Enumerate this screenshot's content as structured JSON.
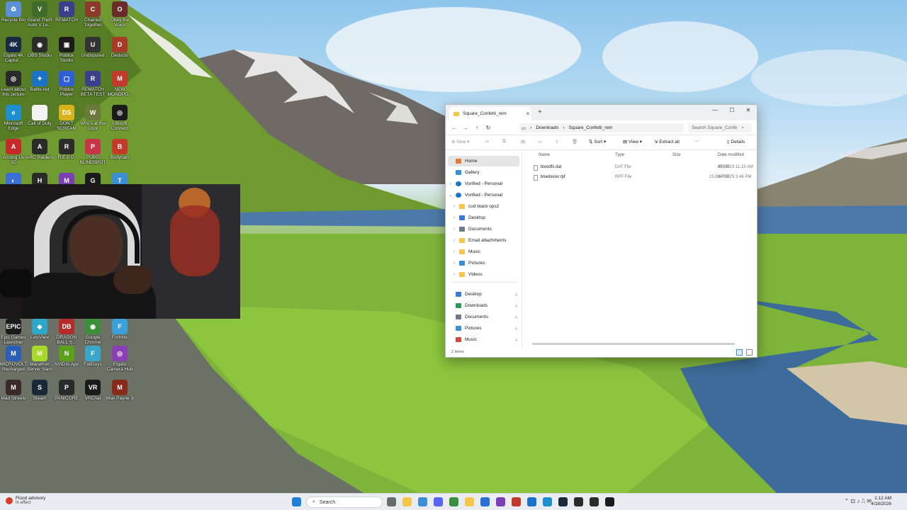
{
  "desktop": {
    "icons": [
      {
        "label": "Recycle Bin",
        "icon": "recycle-bin-icon",
        "color": "#5b8fd6",
        "glyph": "♻"
      },
      {
        "label": "Grand Theft Auto V Le...",
        "icon": "gta-icon",
        "color": "#3f6c2a",
        "glyph": "V"
      },
      {
        "label": "REMATCH",
        "icon": "rematch-icon",
        "color": "#3b3f8a",
        "glyph": "R"
      },
      {
        "label": "Chained Together",
        "icon": "chained-together-icon",
        "color": "#8a3b2b",
        "glyph": "C"
      },
      {
        "label": "Obey the Voice",
        "icon": "obey-icon",
        "color": "#6b2b2b",
        "glyph": "O"
      },
      {
        "label": "Elgato 4K Captur...",
        "icon": "elgato-icon",
        "color": "#1b2a44",
        "glyph": "4K"
      },
      {
        "label": "OBS Studio",
        "icon": "obs-icon",
        "color": "#2b2b2b",
        "glyph": "◉"
      },
      {
        "label": "Roblox Studio",
        "icon": "roblox-studio-icon",
        "color": "#1b1b1b",
        "glyph": "▣"
      },
      {
        "label": "Undisputed",
        "icon": "undisputed-icon",
        "color": "#333",
        "glyph": "U"
      },
      {
        "label": "Deducto",
        "icon": "deducto-icon",
        "color": "#a83a2a",
        "glyph": "D"
      },
      {
        "label": "Learn about this picture",
        "icon": "learn-picture-icon",
        "color": "#2a2a2a",
        "glyph": "◎"
      },
      {
        "label": "Battle.net",
        "icon": "battlenet-icon",
        "color": "#1a73c9",
        "glyph": "✦"
      },
      {
        "label": "Roblox Player",
        "icon": "roblox-player-icon",
        "color": "#2f5ed9",
        "glyph": "▢"
      },
      {
        "label": "REMATCH BETA TEST",
        "icon": "rematch-beta-icon",
        "color": "#3b3f8a",
        "glyph": "R"
      },
      {
        "label": "NEW MONOPO...",
        "icon": "monopoly-icon",
        "color": "#c33a2c",
        "glyph": "M"
      },
      {
        "label": "Microsoft Edge",
        "icon": "edge-icon",
        "color": "#1e8ecf",
        "glyph": "e"
      },
      {
        "label": "Call of Duty",
        "icon": "cod-icon",
        "color": "#f2f2f2",
        "glyph": "□"
      },
      {
        "label": "DON'T SCREAM",
        "icon": "dont-scream-icon",
        "color": "#d9b31a",
        "glyph": "DS"
      },
      {
        "label": "Who's at the Door",
        "icon": "whos-door-icon",
        "color": "#6b7a3a",
        "glyph": "W"
      },
      {
        "label": "Ubisoft Connect",
        "icon": "ubisoft-icon",
        "color": "#1b1b1b",
        "glyph": "◎"
      },
      {
        "label": "Among Us 3D",
        "icon": "among-us-icon",
        "color": "#c42a2a",
        "glyph": "A"
      },
      {
        "label": "ARC Raiders",
        "icon": "arc-raiders-icon",
        "color": "#2b2b2b",
        "glyph": "A"
      },
      {
        "label": "R.E.P.O.",
        "icon": "repo-icon",
        "color": "#2b2b2b",
        "glyph": "R"
      },
      {
        "label": "PUBG BLINDSPOT",
        "icon": "pubg-icon",
        "color": "#c7354a",
        "glyph": "P"
      },
      {
        "label": "Bodycam",
        "icon": "bodycam-icon",
        "color": "#c23a2a",
        "glyph": "B"
      },
      {
        "label": "Chrome Shortcut",
        "icon": "chrome-shortcut-icon",
        "color": "#3b6fd6",
        "glyph": "◐"
      },
      {
        "label": "HACK STUDIO Studio",
        "icon": "hack-studio-icon",
        "color": "#2a2a2a",
        "glyph": "H"
      },
      {
        "label": "Mobile Party",
        "icon": "mobile-party-icon",
        "color": "#7a3fb5",
        "glyph": "M"
      },
      {
        "label": "Logitech G HUB",
        "icon": "logitech-icon",
        "color": "#1b1b1b",
        "glyph": "G"
      },
      {
        "label": "The Texas Chain Saw...",
        "icon": "texas-chainsaw-icon",
        "color": "#3b8fd6",
        "glyph": "T"
      },
      {
        "label": "Epic Games Launcher",
        "icon": "epic-icon",
        "color": "#1b1b1b",
        "glyph": "EPIC"
      },
      {
        "label": "LetsView",
        "icon": "letsview-icon",
        "color": "#2ea8c9",
        "glyph": "◆"
      },
      {
        "label": "DRAGON BALL S...",
        "icon": "dragonball-icon",
        "color": "#b52a2a",
        "glyph": "DB"
      },
      {
        "label": "Google Chrome",
        "icon": "chrome-icon",
        "color": "#3b8f3b",
        "glyph": "◉"
      },
      {
        "label": "Fortnite",
        "icon": "fortnite-icon",
        "color": "#3aa0d9",
        "glyph": "F"
      },
      {
        "label": "MICROVOLTS Recharged",
        "icon": "microvolts-icon",
        "color": "#2a5fb5",
        "glyph": "M"
      },
      {
        "label": "Marathon Server Slam",
        "icon": "marathon-icon",
        "color": "#a8d92a",
        "glyph": "M"
      },
      {
        "label": "NVIDIA App",
        "icon": "nvidia-icon",
        "color": "#5aa01a",
        "glyph": "N"
      },
      {
        "label": "FallGuys",
        "icon": "fallguys-icon",
        "color": "#3aa6c9",
        "glyph": "F"
      },
      {
        "label": "Elgato Camera Hub",
        "icon": "camera-hub-icon",
        "color": "#8a3fb5",
        "glyph": "◎"
      },
      {
        "label": "Mad Streets",
        "icon": "mad-streets-icon",
        "color": "#3a2a2a",
        "glyph": "M"
      },
      {
        "label": "Steam",
        "icon": "steam-icon",
        "color": "#1b2838",
        "glyph": "S"
      },
      {
        "label": "PANICORE",
        "icon": "panicore-icon",
        "color": "#2a2a2a",
        "glyph": "P"
      },
      {
        "label": "VRChat",
        "icon": "vrchat-icon",
        "color": "#1b1b1b",
        "glyph": "VR"
      },
      {
        "label": "Max Payne 3",
        "icon": "max-payne-icon",
        "color": "#8a2a1a",
        "glyph": "M"
      }
    ]
  },
  "explorer": {
    "tab_title": "Square_Confetti_rem",
    "breadcrumbs": [
      "Downloads",
      "Square_Confetti_rem"
    ],
    "search_placeholder": "Search Square_Confe",
    "toolbar": {
      "new": "New",
      "sort": "Sort",
      "view": "View",
      "extract": "Extract all",
      "more": "···",
      "details": "Details"
    },
    "nav": {
      "home": "Home",
      "gallery": "Gallery",
      "onedrive1": "Vorified - Personal",
      "onedrive2": "Vorified - Personal",
      "folders": [
        "cod black ops2",
        "Desktop",
        "Documents",
        "Email attachments",
        "Music",
        "Pictures",
        "Videos"
      ],
      "quick": [
        "Desktop",
        "Downloads",
        "Documents",
        "Pictures",
        "Music"
      ]
    },
    "columns": {
      "name": "Name",
      "type": "Type",
      "size": "Size",
      "date": "Date modified"
    },
    "files": [
      {
        "name": "bloodfx.dat",
        "type": "DAT File",
        "size": "45 KB",
        "date": "3/5/2023 11:15 AM"
      },
      {
        "name": "bluebocer.rpf",
        "type": "RPF File",
        "size": "15,884 KB",
        "date": "8/7/2025 3:46 PM"
      }
    ],
    "status": "2 items"
  },
  "taskbar": {
    "weather_title": "Flood advisory",
    "weather_sub": "In effect",
    "search_label": "Search",
    "time": "1:12 AM",
    "date": "4/18/2026"
  }
}
